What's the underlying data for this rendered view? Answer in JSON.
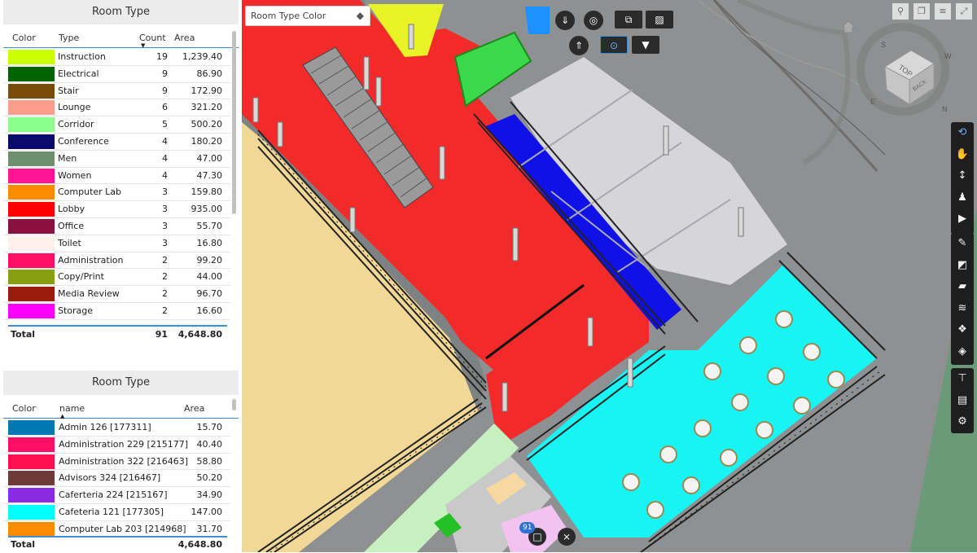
{
  "panel1": {
    "title": "Room Type",
    "headers": {
      "color": "Color",
      "type": "Type",
      "count": "Count",
      "area": "Area"
    },
    "rows": [
      {
        "color": "#ccff00",
        "type": "Instruction",
        "count": "19",
        "area": "1,239.40"
      },
      {
        "color": "#006400",
        "type": "Electrical",
        "count": "9",
        "area": "86.90"
      },
      {
        "color": "#7a4a08",
        "type": "Stair",
        "count": "9",
        "area": "172.90"
      },
      {
        "color": "#ff9d8c",
        "type": "Lounge",
        "count": "6",
        "area": "321.20"
      },
      {
        "color": "#8cff8c",
        "type": "Corridor",
        "count": "5",
        "area": "500.20"
      },
      {
        "color": "#0a0a6e",
        "type": "Conference",
        "count": "4",
        "area": "180.20"
      },
      {
        "color": "#6e8f6e",
        "type": "Men",
        "count": "4",
        "area": "47.00"
      },
      {
        "color": "#ff1493",
        "type": "Women",
        "count": "4",
        "area": "47.30"
      },
      {
        "color": "#ff8c00",
        "type": "Computer Lab",
        "count": "3",
        "area": "159.80"
      },
      {
        "color": "#ff0000",
        "type": "Lobby",
        "count": "3",
        "area": "935.00"
      },
      {
        "color": "#8b1040",
        "type": "Office",
        "count": "3",
        "area": "55.70"
      },
      {
        "color": "#fff0ec",
        "type": "Toilet",
        "count": "3",
        "area": "16.80"
      },
      {
        "color": "#ff1064",
        "type": "Administration",
        "count": "2",
        "area": "99.20"
      },
      {
        "color": "#88a010",
        "type": "Copy/Print",
        "count": "2",
        "area": "44.00"
      },
      {
        "color": "#9b1c0c",
        "type": "Media Review",
        "count": "2",
        "area": "96.70"
      },
      {
        "color": "#ff00ff",
        "type": "Storage",
        "count": "2",
        "area": "16.60"
      }
    ],
    "total": {
      "label": "Total",
      "count": "91",
      "area": "4,648.80"
    }
  },
  "panel2": {
    "title": "Room Type",
    "headers": {
      "color": "Color",
      "name": "name",
      "area": "Area"
    },
    "rows": [
      {
        "color": "#0078b4",
        "name": "Admin 126 [177311]",
        "area": "15.70"
      },
      {
        "color": "#ff1064",
        "name": "Administration 229 [215177]",
        "area": "40.40"
      },
      {
        "color": "#ff1050",
        "name": "Administration 322 [216463]",
        "area": "58.80"
      },
      {
        "color": "#6e3a3a",
        "name": "Advisors 324 [216467]",
        "area": "50.20"
      },
      {
        "color": "#8a2be2",
        "name": "Caferteria 224 [215167]",
        "area": "34.90"
      },
      {
        "color": "#00ffff",
        "name": "Cafeteria 121 [177305]",
        "area": "147.00"
      },
      {
        "color": "#ff8c00",
        "name": "Computer Lab 203 [214968]",
        "area": "31.70"
      }
    ],
    "total": {
      "label": "Total",
      "area": "4,648.80"
    }
  },
  "viewer": {
    "legend_dropdown": "Room Type Color",
    "selection_count": "91",
    "compass_top_label": "TOP",
    "compass_back_label": "BACK",
    "compass_letters": [
      "S",
      "W",
      "E",
      "N"
    ],
    "toolbar_icons": [
      "orbit-icon",
      "pan-icon",
      "zoom-icon",
      "first-person-icon",
      "camera-icon",
      "measure-icon",
      "section-icon",
      "explode-icon",
      "layers-icon",
      "model-browser-icon",
      "properties-icon",
      "model-structure-icon",
      "document-icon",
      "settings-icon"
    ],
    "top_icons": [
      "pin-icon",
      "copy-icon",
      "filter-icon",
      "expand-icon"
    ]
  }
}
